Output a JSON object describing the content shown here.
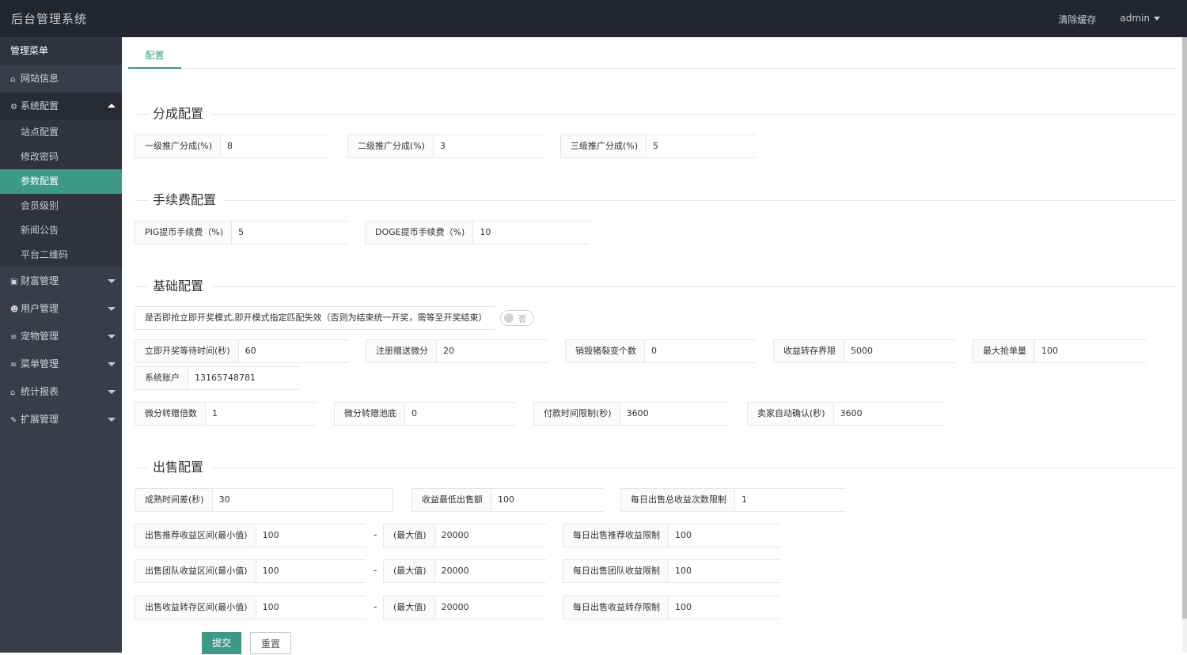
{
  "app": {
    "title": "后台管理系统"
  },
  "topbar": {
    "clear_cache": "清除缓存",
    "user": "admin"
  },
  "sidebar": {
    "header": "管理菜单",
    "items": [
      {
        "label": "网站信息",
        "icon": "home-icon"
      },
      {
        "label": "系统配置",
        "icon": "gears-icon",
        "sub": [
          "站点配置",
          "修改密码",
          "参数配置",
          "会员级别",
          "新闻公告",
          "平台二维码"
        ]
      },
      {
        "label": "财富管理",
        "icon": "money-icon"
      },
      {
        "label": "用户管理",
        "icon": "users-icon"
      },
      {
        "label": "宠物管理",
        "icon": "list-icon"
      },
      {
        "label": "菜单管理",
        "icon": "list-icon"
      },
      {
        "label": "统计报表",
        "icon": "home-icon"
      },
      {
        "label": "扩展管理",
        "icon": "wrench-icon"
      }
    ]
  },
  "tabs": {
    "config": "配置"
  },
  "sections": {
    "share": "分成配置",
    "fee": "手续费配置",
    "basic": "基础配置",
    "sale": "出售配置"
  },
  "share": {
    "level1": {
      "label": "一级推广分成(%)",
      "value": "8"
    },
    "level2": {
      "label": "二级推广分成(%)",
      "value": "3"
    },
    "level3": {
      "label": "三级推广分成(%)",
      "value": "5"
    }
  },
  "fee": {
    "pig": {
      "label": "PIG提币手续费（%)",
      "value": "5"
    },
    "doge": {
      "label": "DOGE提币手续费（%)",
      "value": "10"
    }
  },
  "basic": {
    "instant": {
      "label": "是否即抢立即开奖模式,即开模式指定匹配失效（否则为结束统一开奖，需等至开奖结束）",
      "switch": "否"
    },
    "wait": {
      "label": "立即开奖等待时间(秒)",
      "value": "60"
    },
    "reg_gift": {
      "label": "注册赠送微分",
      "value": "20"
    },
    "destroy": {
      "label": "销毁猪裂变个数",
      "value": "0"
    },
    "transfer_limit": {
      "label": "收益转存界限",
      "value": "5000"
    },
    "max_grab": {
      "label": "最大抢单量",
      "value": "100"
    },
    "sys_account": {
      "label": "系统账户",
      "value": "13165748781"
    },
    "gift_multiple": {
      "label": "微分转赠倍数",
      "value": "1"
    },
    "gift_pool": {
      "label": "微分转赠池底",
      "value": "0"
    },
    "pay_limit": {
      "label": "付款时间限制(秒)",
      "value": "3600"
    },
    "auto_confirm": {
      "label": "卖家自动确认(秒)",
      "value": "3600"
    }
  },
  "sale": {
    "mature_diff": {
      "label": "成熟时间差(秒)",
      "value": "30"
    },
    "min_sale": {
      "label": "收益最低出售额",
      "value": "100"
    },
    "daily_count": {
      "label": "每日出售总收益次数限制",
      "value": "1"
    },
    "dash": "-",
    "max_label": "(最大值)",
    "rows": [
      {
        "min_label": "出售推荐收益区间(最小值)",
        "min": "100",
        "max": "20000",
        "limit_label": "每日出售推荐收益限制",
        "limit": "100"
      },
      {
        "min_label": "出售团队收益区间(最小值)",
        "min": "100",
        "max": "20000",
        "limit_label": "每日出售团队收益限制",
        "limit": "100"
      },
      {
        "min_label": "出售收益转存区间(最小值)",
        "min": "100",
        "max": "20000",
        "limit_label": "每日出售收益转存限制",
        "limit": "100"
      }
    ]
  },
  "buttons": {
    "submit": "提交",
    "reset": "重置"
  },
  "colors": {
    "accent": "#3e9a86",
    "topbar": "#23262e",
    "sidebar": "#393d49"
  }
}
